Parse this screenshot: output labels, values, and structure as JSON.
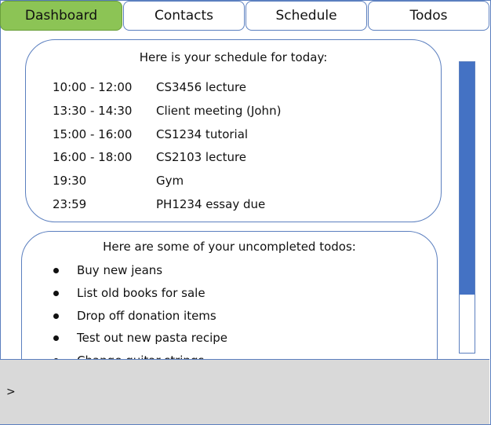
{
  "tabs": [
    {
      "label": "Dashboard",
      "active": true
    },
    {
      "label": "Contacts",
      "active": false
    },
    {
      "label": "Schedule",
      "active": false
    },
    {
      "label": "Todos",
      "active": false
    }
  ],
  "schedule": {
    "heading": "Here is your schedule for today:",
    "items": [
      {
        "time": "10:00 - 12:00",
        "event": "CS3456 lecture"
      },
      {
        "time": "13:30 - 14:30",
        "event": "Client meeting (John)"
      },
      {
        "time": "15:00 - 16:00",
        "event": "CS1234 tutorial"
      },
      {
        "time": "16:00 - 18:00",
        "event": "CS2103 lecture"
      },
      {
        "time": "19:30",
        "event": "Gym"
      },
      {
        "time": "23:59",
        "event": "PH1234 essay due"
      }
    ]
  },
  "todos": {
    "heading": "Here are some of your uncompleted todos:",
    "items": [
      "Buy new jeans",
      "List old books for sale",
      "Drop off donation items",
      "Test out new pasta recipe",
      "Change guitar strings"
    ]
  },
  "scrollbar": {
    "position_fraction": 0.0,
    "visible_fraction": 0.8
  },
  "command": {
    "prompt": ">"
  },
  "colors": {
    "active_tab": "#8cc455",
    "border": "#5b7fbf",
    "scroll_thumb": "#4472c4",
    "command_bg": "#d9d9d9"
  }
}
